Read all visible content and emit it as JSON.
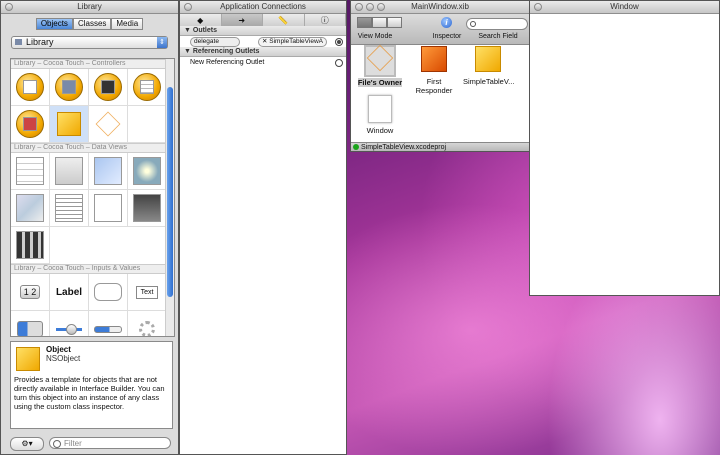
{
  "library": {
    "title": "Library",
    "tabs": [
      "Objects",
      "Classes",
      "Media"
    ],
    "source": "Library",
    "sections": [
      "Library – Cocoa Touch – Controllers",
      "Library – Cocoa Touch – Data Views",
      "Library – Cocoa Touch – Inputs & Values"
    ],
    "widgets": {
      "label": "Label",
      "text": "Text",
      "segmented": "1 2"
    },
    "detail": {
      "name": "Object",
      "class": "NSObject",
      "description": "Provides a template for objects that are not directly available in Interface Builder. You can turn this object into an instance of any class using the custom class inspector."
    },
    "filter_placeholder": "Filter",
    "gear": "⚙▾"
  },
  "connections": {
    "title": "Application Connections",
    "outlets_header": "Outlets",
    "outlet_name": "delegate",
    "outlet_target": "SimpleTableViewA",
    "ref_header": "Referencing Outlets",
    "ref_item": "New Referencing Outlet"
  },
  "xib": {
    "title": "MainWindow.xib",
    "toolbar": {
      "view_mode": "View Mode",
      "inspector": "Inspector",
      "search": "Search Field"
    },
    "objects": [
      "File's Owner",
      "First Responder",
      "SimpleTableV...",
      "Window"
    ],
    "status": "SimpleTableView.xcodeproj"
  },
  "window": {
    "title": "Window"
  }
}
